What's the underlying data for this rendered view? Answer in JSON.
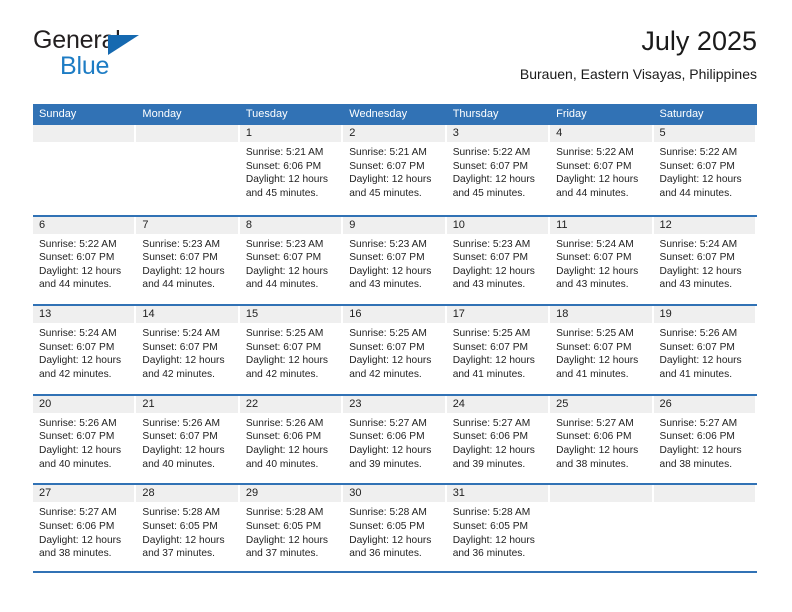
{
  "brand": {
    "name_part1": "General",
    "name_part2": "Blue",
    "triangle_color": "#1569b0",
    "blue_color": "#1d7cc4"
  },
  "header": {
    "title": "July 2025",
    "subtitle": "Burauen, Eastern Visayas, Philippines"
  },
  "theme": {
    "header_blue": "#3172b5",
    "band_gray": "#efefef",
    "text": "#222222"
  },
  "calendar": {
    "weekday_headers": [
      "Sunday",
      "Monday",
      "Tuesday",
      "Wednesday",
      "Thursday",
      "Friday",
      "Saturday"
    ],
    "weeks": [
      [
        {
          "day": "",
          "sunrise": "",
          "sunset": "",
          "daylight_1": "",
          "daylight_2": ""
        },
        {
          "day": "",
          "sunrise": "",
          "sunset": "",
          "daylight_1": "",
          "daylight_2": ""
        },
        {
          "day": "1",
          "sunrise": "Sunrise: 5:21 AM",
          "sunset": "Sunset: 6:06 PM",
          "daylight_1": "Daylight: 12 hours",
          "daylight_2": "and 45 minutes."
        },
        {
          "day": "2",
          "sunrise": "Sunrise: 5:21 AM",
          "sunset": "Sunset: 6:07 PM",
          "daylight_1": "Daylight: 12 hours",
          "daylight_2": "and 45 minutes."
        },
        {
          "day": "3",
          "sunrise": "Sunrise: 5:22 AM",
          "sunset": "Sunset: 6:07 PM",
          "daylight_1": "Daylight: 12 hours",
          "daylight_2": "and 45 minutes."
        },
        {
          "day": "4",
          "sunrise": "Sunrise: 5:22 AM",
          "sunset": "Sunset: 6:07 PM",
          "daylight_1": "Daylight: 12 hours",
          "daylight_2": "and 44 minutes."
        },
        {
          "day": "5",
          "sunrise": "Sunrise: 5:22 AM",
          "sunset": "Sunset: 6:07 PM",
          "daylight_1": "Daylight: 12 hours",
          "daylight_2": "and 44 minutes."
        }
      ],
      [
        {
          "day": "6",
          "sunrise": "Sunrise: 5:22 AM",
          "sunset": "Sunset: 6:07 PM",
          "daylight_1": "Daylight: 12 hours",
          "daylight_2": "and 44 minutes."
        },
        {
          "day": "7",
          "sunrise": "Sunrise: 5:23 AM",
          "sunset": "Sunset: 6:07 PM",
          "daylight_1": "Daylight: 12 hours",
          "daylight_2": "and 44 minutes."
        },
        {
          "day": "8",
          "sunrise": "Sunrise: 5:23 AM",
          "sunset": "Sunset: 6:07 PM",
          "daylight_1": "Daylight: 12 hours",
          "daylight_2": "and 44 minutes."
        },
        {
          "day": "9",
          "sunrise": "Sunrise: 5:23 AM",
          "sunset": "Sunset: 6:07 PM",
          "daylight_1": "Daylight: 12 hours",
          "daylight_2": "and 43 minutes."
        },
        {
          "day": "10",
          "sunrise": "Sunrise: 5:23 AM",
          "sunset": "Sunset: 6:07 PM",
          "daylight_1": "Daylight: 12 hours",
          "daylight_2": "and 43 minutes."
        },
        {
          "day": "11",
          "sunrise": "Sunrise: 5:24 AM",
          "sunset": "Sunset: 6:07 PM",
          "daylight_1": "Daylight: 12 hours",
          "daylight_2": "and 43 minutes."
        },
        {
          "day": "12",
          "sunrise": "Sunrise: 5:24 AM",
          "sunset": "Sunset: 6:07 PM",
          "daylight_1": "Daylight: 12 hours",
          "daylight_2": "and 43 minutes."
        }
      ],
      [
        {
          "day": "13",
          "sunrise": "Sunrise: 5:24 AM",
          "sunset": "Sunset: 6:07 PM",
          "daylight_1": "Daylight: 12 hours",
          "daylight_2": "and 42 minutes."
        },
        {
          "day": "14",
          "sunrise": "Sunrise: 5:24 AM",
          "sunset": "Sunset: 6:07 PM",
          "daylight_1": "Daylight: 12 hours",
          "daylight_2": "and 42 minutes."
        },
        {
          "day": "15",
          "sunrise": "Sunrise: 5:25 AM",
          "sunset": "Sunset: 6:07 PM",
          "daylight_1": "Daylight: 12 hours",
          "daylight_2": "and 42 minutes."
        },
        {
          "day": "16",
          "sunrise": "Sunrise: 5:25 AM",
          "sunset": "Sunset: 6:07 PM",
          "daylight_1": "Daylight: 12 hours",
          "daylight_2": "and 42 minutes."
        },
        {
          "day": "17",
          "sunrise": "Sunrise: 5:25 AM",
          "sunset": "Sunset: 6:07 PM",
          "daylight_1": "Daylight: 12 hours",
          "daylight_2": "and 41 minutes."
        },
        {
          "day": "18",
          "sunrise": "Sunrise: 5:25 AM",
          "sunset": "Sunset: 6:07 PM",
          "daylight_1": "Daylight: 12 hours",
          "daylight_2": "and 41 minutes."
        },
        {
          "day": "19",
          "sunrise": "Sunrise: 5:26 AM",
          "sunset": "Sunset: 6:07 PM",
          "daylight_1": "Daylight: 12 hours",
          "daylight_2": "and 41 minutes."
        }
      ],
      [
        {
          "day": "20",
          "sunrise": "Sunrise: 5:26 AM",
          "sunset": "Sunset: 6:07 PM",
          "daylight_1": "Daylight: 12 hours",
          "daylight_2": "and 40 minutes."
        },
        {
          "day": "21",
          "sunrise": "Sunrise: 5:26 AM",
          "sunset": "Sunset: 6:07 PM",
          "daylight_1": "Daylight: 12 hours",
          "daylight_2": "and 40 minutes."
        },
        {
          "day": "22",
          "sunrise": "Sunrise: 5:26 AM",
          "sunset": "Sunset: 6:06 PM",
          "daylight_1": "Daylight: 12 hours",
          "daylight_2": "and 40 minutes."
        },
        {
          "day": "23",
          "sunrise": "Sunrise: 5:27 AM",
          "sunset": "Sunset: 6:06 PM",
          "daylight_1": "Daylight: 12 hours",
          "daylight_2": "and 39 minutes."
        },
        {
          "day": "24",
          "sunrise": "Sunrise: 5:27 AM",
          "sunset": "Sunset: 6:06 PM",
          "daylight_1": "Daylight: 12 hours",
          "daylight_2": "and 39 minutes."
        },
        {
          "day": "25",
          "sunrise": "Sunrise: 5:27 AM",
          "sunset": "Sunset: 6:06 PM",
          "daylight_1": "Daylight: 12 hours",
          "daylight_2": "and 38 minutes."
        },
        {
          "day": "26",
          "sunrise": "Sunrise: 5:27 AM",
          "sunset": "Sunset: 6:06 PM",
          "daylight_1": "Daylight: 12 hours",
          "daylight_2": "and 38 minutes."
        }
      ],
      [
        {
          "day": "27",
          "sunrise": "Sunrise: 5:27 AM",
          "sunset": "Sunset: 6:06 PM",
          "daylight_1": "Daylight: 12 hours",
          "daylight_2": "and 38 minutes."
        },
        {
          "day": "28",
          "sunrise": "Sunrise: 5:28 AM",
          "sunset": "Sunset: 6:05 PM",
          "daylight_1": "Daylight: 12 hours",
          "daylight_2": "and 37 minutes."
        },
        {
          "day": "29",
          "sunrise": "Sunrise: 5:28 AM",
          "sunset": "Sunset: 6:05 PM",
          "daylight_1": "Daylight: 12 hours",
          "daylight_2": "and 37 minutes."
        },
        {
          "day": "30",
          "sunrise": "Sunrise: 5:28 AM",
          "sunset": "Sunset: 6:05 PM",
          "daylight_1": "Daylight: 12 hours",
          "daylight_2": "and 36 minutes."
        },
        {
          "day": "31",
          "sunrise": "Sunrise: 5:28 AM",
          "sunset": "Sunset: 6:05 PM",
          "daylight_1": "Daylight: 12 hours",
          "daylight_2": "and 36 minutes."
        },
        {
          "day": "",
          "sunrise": "",
          "sunset": "",
          "daylight_1": "",
          "daylight_2": ""
        },
        {
          "day": "",
          "sunrise": "",
          "sunset": "",
          "daylight_1": "",
          "daylight_2": ""
        }
      ]
    ]
  }
}
